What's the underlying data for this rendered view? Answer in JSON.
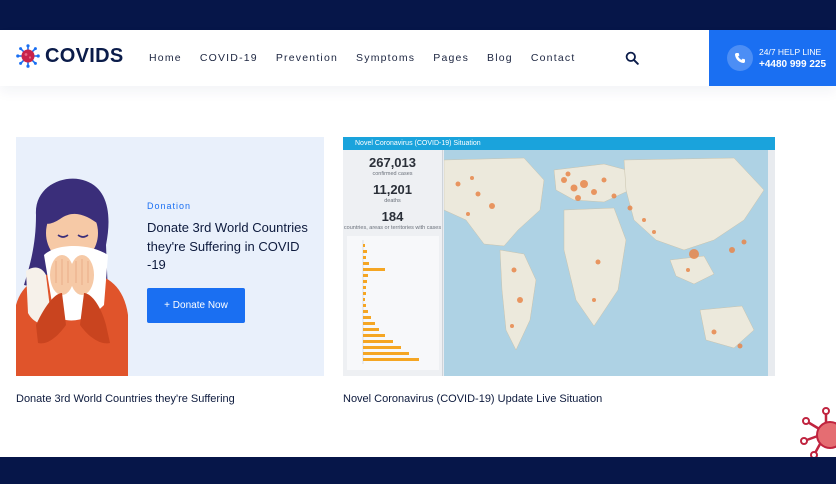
{
  "brand": {
    "name": "COVIDS",
    "logo_icon": "virus-icon"
  },
  "nav": {
    "items": [
      "Home",
      "COVID-19",
      "Prevention",
      "Symptoms",
      "Pages",
      "Blog",
      "Contact"
    ]
  },
  "helpline": {
    "label": "24/7 HELP LINE",
    "number": "+4480 999 225"
  },
  "promo": {
    "tag": "Donation",
    "title": "Donate 3rd World Countries they're Suffering in COVID -19",
    "button_label": "+ Donate Now",
    "caption": "Donate 3rd World Countries they're Suffering"
  },
  "dashboard": {
    "title": "Novel Coronavirus (COVID-19) Situation",
    "confirmed": {
      "value": "267,013",
      "label": "confirmed cases"
    },
    "deaths": {
      "value": "11,201",
      "label": "deaths"
    },
    "countries": {
      "value": "184",
      "label": "countries, areas or territories with cases"
    },
    "caption": "Novel Coronavirus (COVID-19) Update Live Situation"
  },
  "colors": {
    "primary": "#1a6ff2",
    "navy": "#061649",
    "map_bubble": "#e8864a",
    "dashboard_bar": "#f5a623"
  }
}
